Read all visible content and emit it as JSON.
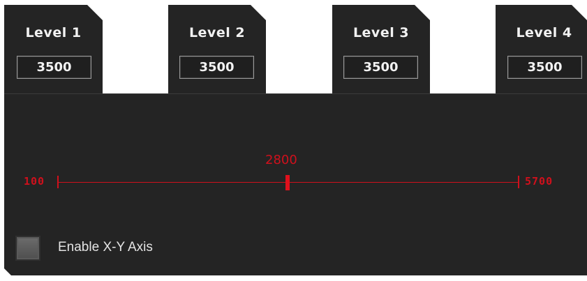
{
  "levels": [
    {
      "label": "Level 1",
      "dpi": "3500"
    },
    {
      "label": "Level 2",
      "dpi": "3500"
    },
    {
      "label": "Level 3",
      "dpi": "3500"
    },
    {
      "label": "Level 4",
      "dpi": "3500"
    }
  ],
  "slider": {
    "min_label": "100",
    "max_label": "5700",
    "value_label": "2800",
    "value": 2800,
    "min": 100,
    "max": 5700
  },
  "xy_axis": {
    "label": "Enable X-Y Axis",
    "checked": false
  },
  "colors": {
    "accent": "#d0101c",
    "panel": "#242424"
  }
}
